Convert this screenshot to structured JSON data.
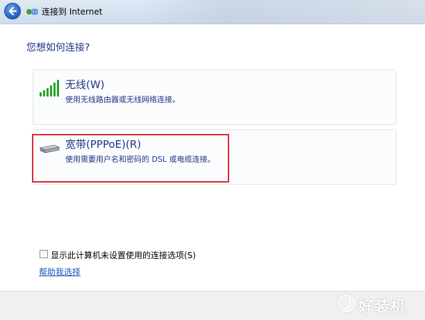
{
  "window": {
    "title": "连接到 Internet",
    "back_icon": "back-arrow-icon",
    "app_icon": "network-globe-icon"
  },
  "heading": "您想如何连接?",
  "options": [
    {
      "title": "无线(W)",
      "description": "使用无线路由器或无线网络连接。",
      "icon": "wireless-signal-icon",
      "highlighted": false
    },
    {
      "title": "宽带(PPPoE)(R)",
      "description": "使用需要用户名和密码的 DSL 或电缆连接。",
      "icon": "modem-icon",
      "highlighted": true
    }
  ],
  "show_unconfigured": {
    "label": "显示此计算机未设置使用的连接选项(S)",
    "checked": false
  },
  "help_link": "帮助我选择",
  "watermark": {
    "text": "好装机",
    "icon": "watermark-logo-icon"
  },
  "colors": {
    "heading": "#1e3287",
    "link": "#1a56b8",
    "highlight_border": "#d9272e",
    "signal_green": "#2aa12a"
  }
}
